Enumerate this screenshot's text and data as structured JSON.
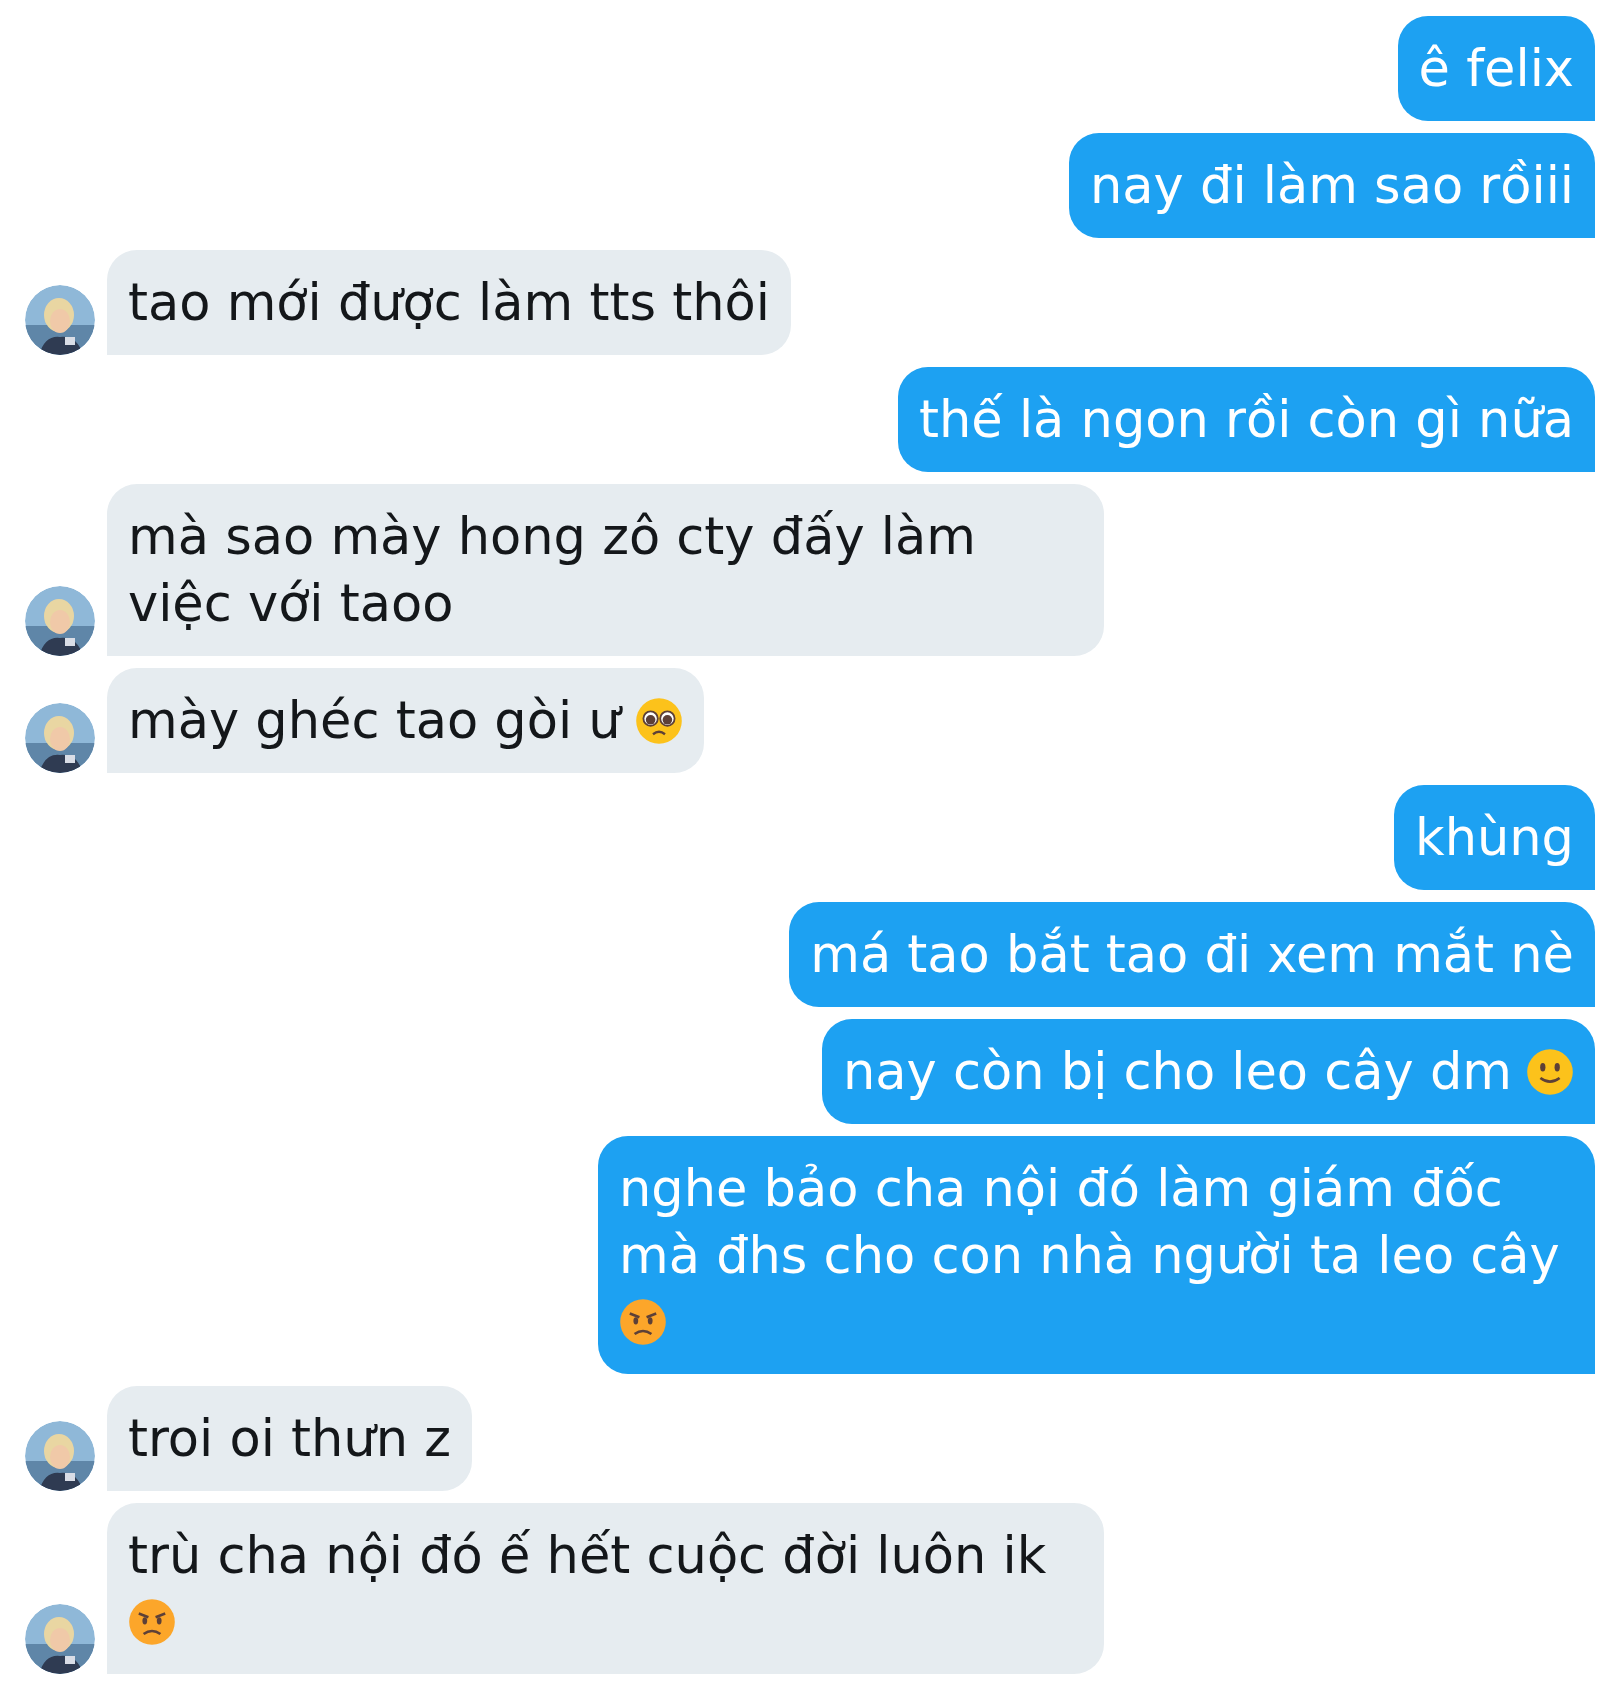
{
  "messages": [
    {
      "kind": "sent",
      "text": "ê felix"
    },
    {
      "kind": "sent",
      "text": "nay đi làm sao rồiii"
    },
    {
      "kind": "received",
      "text": "tao mới được làm tts thôi"
    },
    {
      "kind": "sent",
      "text": "thế là ngon rồi còn gì nữa"
    },
    {
      "kind": "received",
      "text": "mà sao mày hong zô cty đấy làm việc với taoo"
    },
    {
      "kind": "received",
      "text": "mày ghéc tao gòi ư",
      "emoji": {
        "kind": "pleading"
      }
    },
    {
      "kind": "sent",
      "text": "khùng"
    },
    {
      "kind": "sent",
      "text": "má tao bắt tao đi xem mắt nè"
    },
    {
      "kind": "sent",
      "text": "nay còn bị cho leo cây dm",
      "emoji": {
        "kind": "smile"
      }
    },
    {
      "kind": "sent",
      "text": "nghe bảo cha nội đó làm giám đốc mà đhs cho con nhà người ta leo cây",
      "emoji": {
        "kind": "angry"
      }
    },
    {
      "kind": "received",
      "text": "troi oi thưn z"
    },
    {
      "kind": "received",
      "text": "trù cha nội đó ế hết cuộc đời luôn ik",
      "emoji": {
        "kind": "angry"
      }
    }
  ]
}
